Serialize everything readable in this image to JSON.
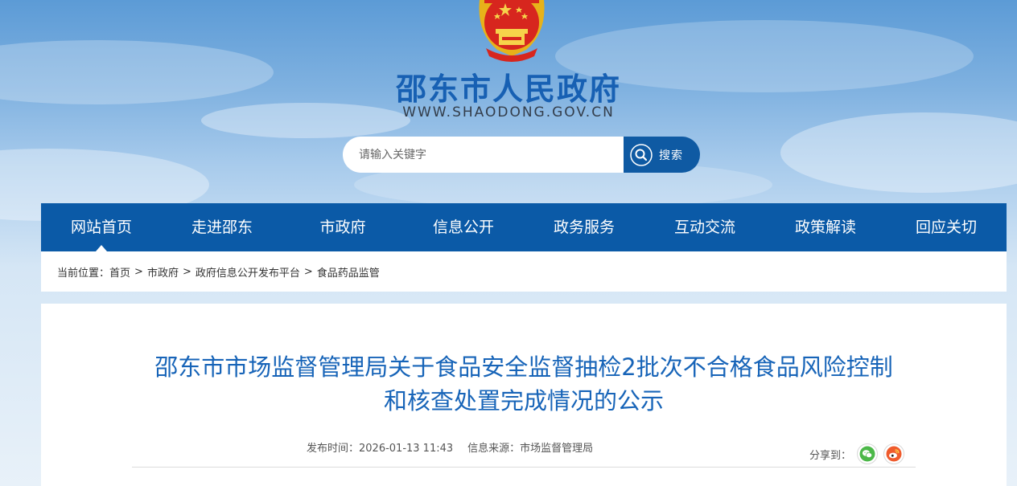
{
  "header": {
    "site_title": "邵东市人民政府",
    "site_url": "WWW.SHAODONG.GOV.CN",
    "emblem_icon": "national-emblem-icon"
  },
  "search": {
    "placeholder": "请输入关键字",
    "button_label": "搜索",
    "icon": "search-icon"
  },
  "nav": {
    "items": [
      {
        "label": "网站首页"
      },
      {
        "label": "走进邵东"
      },
      {
        "label": "市政府"
      },
      {
        "label": "信息公开"
      },
      {
        "label": "政务服务"
      },
      {
        "label": "互动交流"
      },
      {
        "label": "政策解读"
      },
      {
        "label": "回应关切"
      }
    ]
  },
  "breadcrumb": {
    "prefix": "当前位置：",
    "items": [
      "首页",
      "市政府",
      "政府信息公开发布平台",
      "食品药品监管"
    ],
    "separator": ">"
  },
  "article": {
    "title_line1": "邵东市市场监督管理局关于食品安全监督抽检2批次不合格食品风险控制",
    "title_line2": "和核查处置完成情况的公示",
    "publish_time": "发布时间：2026-01-13 11:43",
    "source": "信息来源：市场监督管理局"
  },
  "share": {
    "label": "分享到：",
    "icons": [
      "wechat-icon",
      "weibo-icon"
    ]
  },
  "colors": {
    "nav_bg": "#0b5aa7",
    "title_blue": "#1764b8",
    "site_title_blue": "#1760b3"
  }
}
